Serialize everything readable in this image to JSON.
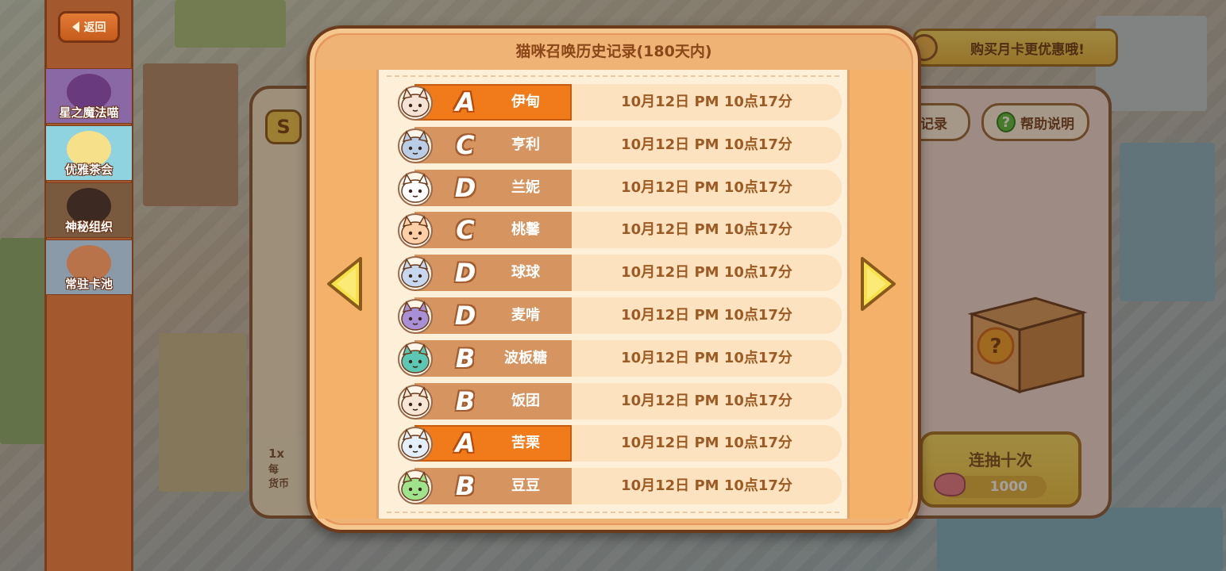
{
  "colors": {
    "dialog_border": "#6b3b1c",
    "dialog_fill": "#e6985e",
    "list_bg": "#fdefd8",
    "row_bg": "#fce2bf",
    "tag_normal": "#d69461",
    "tag_rare": "#f17a1a",
    "time_text": "#9c5a24",
    "arrow_fill": "#f6e14b"
  },
  "sidebar": {
    "back_label": "返回",
    "pools": [
      {
        "label": "星之魔法喵"
      },
      {
        "label": "优雅茶会"
      },
      {
        "label": "神秘组织"
      },
      {
        "label": "常驻卡池"
      }
    ]
  },
  "background": {
    "month_card_label": "购买月卡更优惠哦!",
    "record_button_label": "记录",
    "help_button_label": "帮助说明",
    "ten_pull_label": "连抽十次",
    "ten_pull_cost": "1000",
    "single_pull_multiplier": "1x",
    "single_pull_note_line1": "每",
    "single_pull_note_line2": "货币",
    "badge_letter": "S"
  },
  "dialog": {
    "title": "猫咪召唤历史记录(180天内)",
    "records": [
      {
        "grade": "A",
        "name": "伊甸",
        "time": "10月12日 PM 10点17分",
        "rare": true,
        "avatar": "girl-red-bow-avatar-icon",
        "color": "#f5e4d5"
      },
      {
        "grade": "C",
        "name": "亨利",
        "time": "10月12日 PM 10点17分",
        "rare": false,
        "avatar": "blue-cat-avatar-icon",
        "color": "#b9cde6"
      },
      {
        "grade": "D",
        "name": "兰妮",
        "time": "10月12日 PM 10点17分",
        "rare": false,
        "avatar": "white-cat-avatar-icon",
        "color": "#ffffff"
      },
      {
        "grade": "C",
        "name": "桃馨",
        "time": "10月12日 PM 10点17分",
        "rare": false,
        "avatar": "peach-cat-avatar-icon",
        "color": "#ffcfa8"
      },
      {
        "grade": "D",
        "name": "球球",
        "time": "10月12日 PM 10点17分",
        "rare": false,
        "avatar": "blue-cat-avatar-icon",
        "color": "#c6d7ef"
      },
      {
        "grade": "D",
        "name": "麦啃",
        "time": "10月12日 PM 10点17分",
        "rare": false,
        "avatar": "purple-cat-avatar-icon",
        "color": "#a98fd6"
      },
      {
        "grade": "B",
        "name": "波板糖",
        "time": "10月12日 PM 10点17分",
        "rare": false,
        "avatar": "teal-cat-avatar-icon",
        "color": "#5cc7b4"
      },
      {
        "grade": "B",
        "name": "饭团",
        "time": "10月12日 PM 10点17分",
        "rare": false,
        "avatar": "brown-hair-cat-avatar-icon",
        "color": "#f6e6d6"
      },
      {
        "grade": "A",
        "name": "苦栗",
        "time": "10月12日 PM 10点17分",
        "rare": true,
        "avatar": "light-blue-cat-avatar-icon",
        "color": "#e3f0fb"
      },
      {
        "grade": "B",
        "name": "豆豆",
        "time": "10月12日 PM 10点17分",
        "rare": false,
        "avatar": "green-cat-avatar-icon",
        "color": "#9fe38d"
      }
    ]
  }
}
